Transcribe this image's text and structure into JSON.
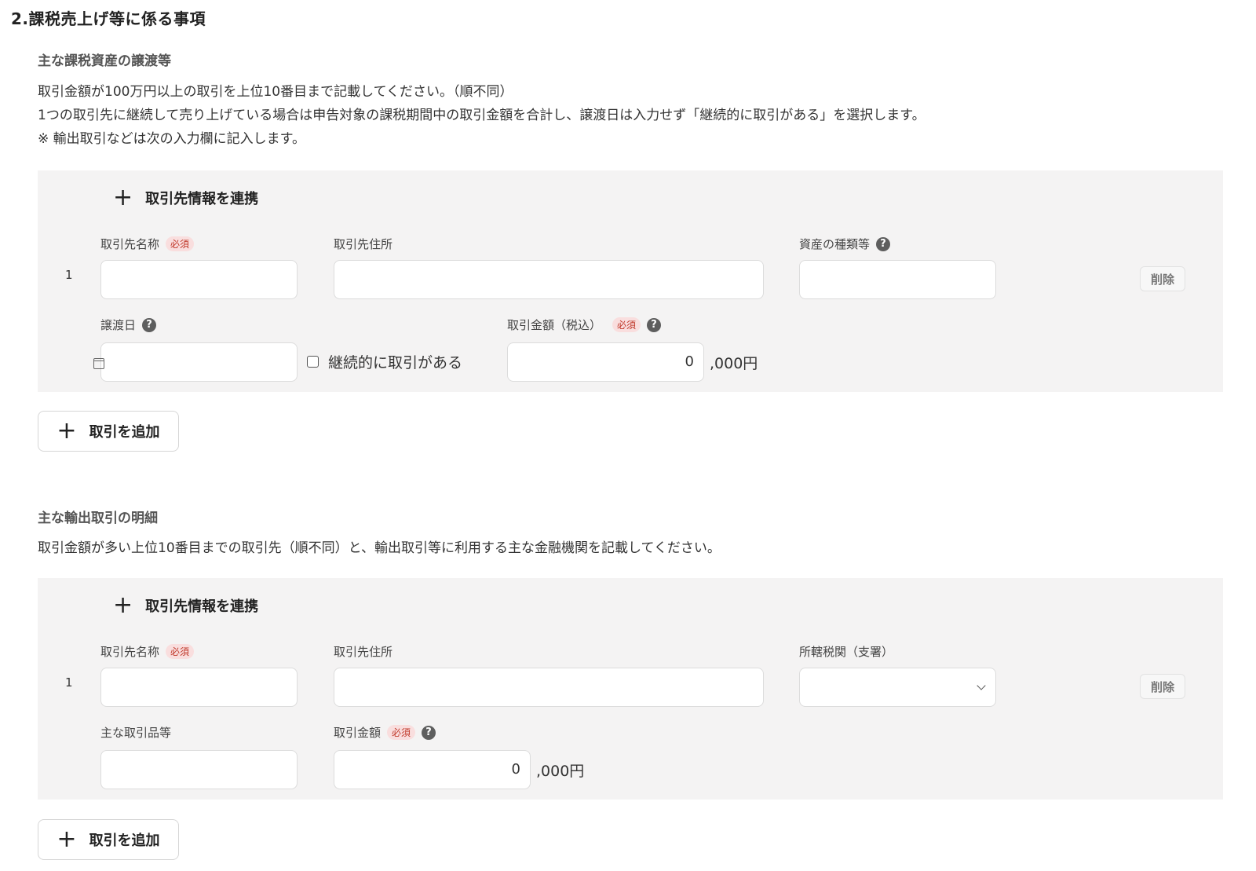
{
  "section_title": "2.課税売上げ等に係る事項",
  "sec1": {
    "heading": "主な課税資産の譲渡等",
    "desc_lines": [
      "取引金額が100万円以上の取引を上位10番目まで記載してください。（順不同）",
      "1つの取引先に継続して売り上げている場合は申告対象の課税期間中の取引金額を合計し、譲渡日は入力せず「継続的に取引がある」を選択します。",
      "※ 輸出取引などは次の入力欄に記入します。"
    ],
    "link_label": "取引先情報を連携",
    "row_number": "1",
    "fields": {
      "name_label": "取引先名称",
      "address_label": "取引先住所",
      "asset_label": "資産の種類等",
      "date_label": "譲渡日",
      "continuous_label": "継続的に取引がある",
      "amount_label": "取引金額（税込）",
      "amount_value": "0",
      "unit": ",000円"
    },
    "delete_label": "削除",
    "add_label": "取引を追加"
  },
  "sec2": {
    "heading": "主な輸出取引の明細",
    "desc": "取引金額が多い上位10番目までの取引先（順不同）と、輸出取引等に利用する主な金融機関を記載してください。",
    "link_label": "取引先情報を連携",
    "row_number": "1",
    "fields": {
      "name_label": "取引先名称",
      "address_label": "取引先住所",
      "office_label": "所轄税関（支署）",
      "goods_label": "主な取引品等",
      "amount_label": "取引金額",
      "amount_value": "0",
      "unit": ",000円"
    },
    "delete_label": "削除",
    "add_label": "取引を追加"
  },
  "common": {
    "required": "必須",
    "help": "?",
    "plus": "+"
  },
  "icons": [
    "plus-icon",
    "help-icon",
    "calendar-icon",
    "checkbox",
    "chevron-down-icon"
  ]
}
